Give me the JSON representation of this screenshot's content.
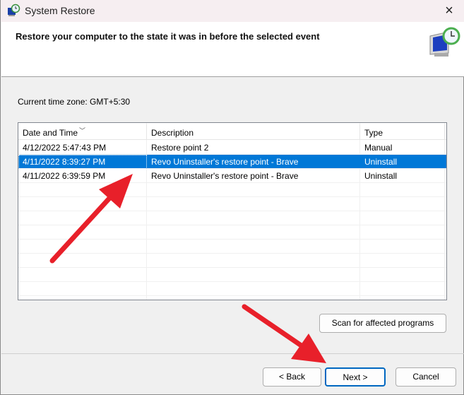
{
  "window": {
    "title": "System Restore",
    "close_icon": "×"
  },
  "header": {
    "text": "Restore your computer to the state it was in before the selected event"
  },
  "timezone": "Current time zone: GMT+5:30",
  "table": {
    "columns": [
      "Date and Time",
      "Description",
      "Type"
    ],
    "rows": [
      {
        "date": "4/12/2022 5:47:43 PM",
        "description": "Restore point 2",
        "type": "Manual",
        "selected": false
      },
      {
        "date": "4/11/2022 8:39:27 PM",
        "description": "Revo Uninstaller's restore point - Brave",
        "type": "Uninstall",
        "selected": true
      },
      {
        "date": "4/11/2022 6:39:59 PM",
        "description": "Revo Uninstaller's restore point - Brave",
        "type": "Uninstall",
        "selected": false
      }
    ]
  },
  "buttons": {
    "scan": "Scan for affected programs",
    "back": "< Back",
    "next": "Next >",
    "cancel": "Cancel"
  },
  "colors": {
    "selection": "#0078d7",
    "annotation": "#e8202a"
  }
}
